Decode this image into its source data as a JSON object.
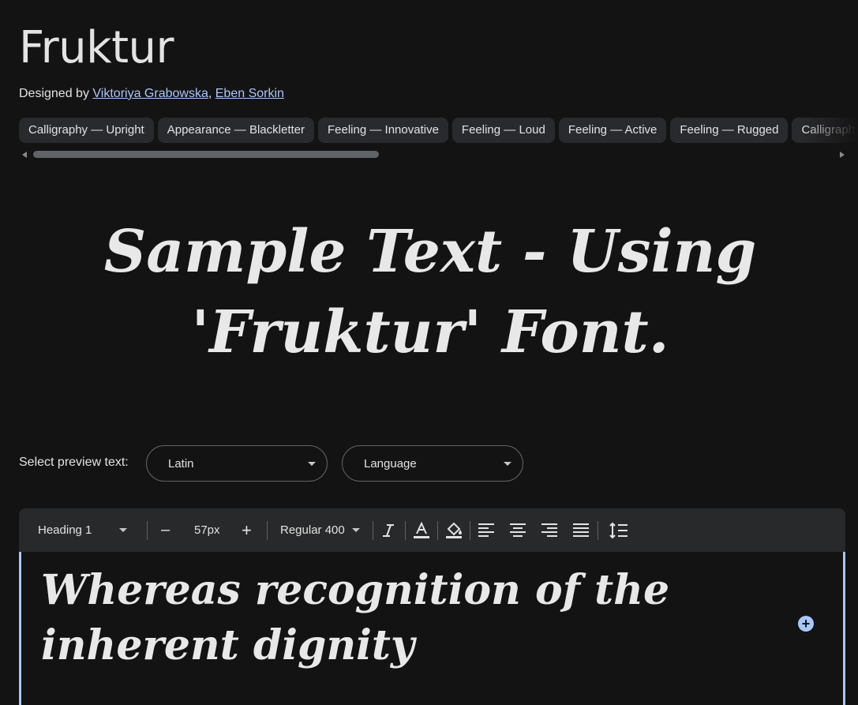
{
  "font": {
    "name": "Fruktur",
    "designed_by_prefix": "Designed by",
    "designers": [
      "Viktoriya Grabowska",
      "Eben Sorkin"
    ],
    "designer_separator": ","
  },
  "tags": [
    "Calligraphy — Upright",
    "Appearance — Blackletter",
    "Feeling — Innovative",
    "Feeling — Loud",
    "Feeling — Active",
    "Feeling — Rugged",
    "Calligraphy"
  ],
  "sample_text": "Sample Text - Using 'Fruktur' Font.",
  "preview": {
    "label": "Select preview text:",
    "script_select": "Latin",
    "language_select": "Language"
  },
  "toolbar": {
    "style": "Heading 1",
    "decrease": "–",
    "size": "57px",
    "increase": "+",
    "weight": "Regular 400",
    "accent_color": "#a8c7fa"
  },
  "editor": {
    "text": "Whereas recognition of the inherent dignity",
    "add_label": "+"
  }
}
